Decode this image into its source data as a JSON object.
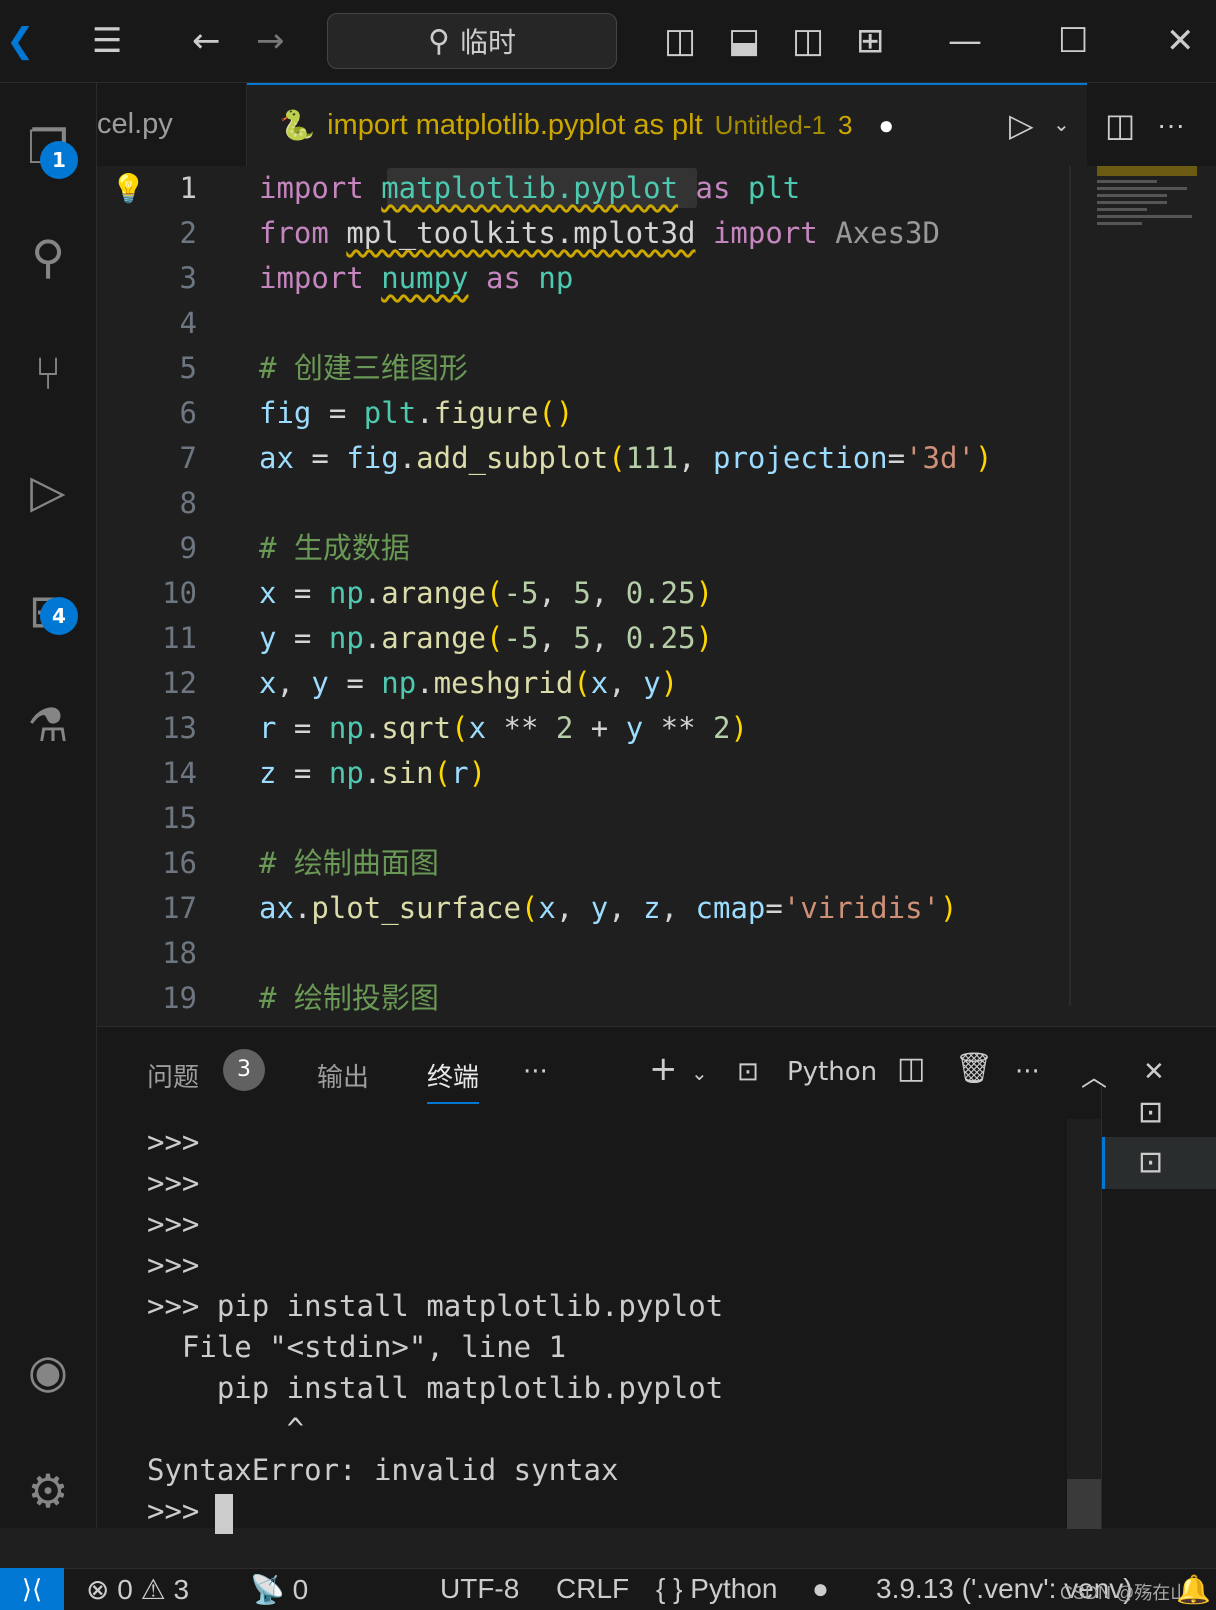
{
  "titlebar": {
    "search_text": "临时"
  },
  "activity": {
    "explorer_badge": "1",
    "extensions_badge": "4"
  },
  "tabs": [
    {
      "label": "cel.py"
    },
    {
      "label": "import matplotlib.pyplot as plt",
      "sublabel": "Untitled-1",
      "problems": "3"
    }
  ],
  "editor": {
    "lines": [
      [
        [
          "kw",
          "import "
        ],
        [
          "md sq",
          "matplotlib.pyplot"
        ],
        [
          "kw",
          " as "
        ],
        [
          "md",
          "plt"
        ]
      ],
      [
        [
          "kw",
          "from "
        ],
        [
          "p sq",
          "mpl_toolkits.mplot3d"
        ],
        [
          "kw",
          " import "
        ],
        [
          "cls",
          "Axes3D"
        ]
      ],
      [
        [
          "kw",
          "import "
        ],
        [
          "md sq",
          "numpy"
        ],
        [
          "kw",
          " as "
        ],
        [
          "md",
          "np"
        ]
      ],
      [],
      [
        [
          "c",
          "# 创建三维图形"
        ]
      ],
      [
        [
          "v",
          "fig"
        ],
        [
          "p",
          " = "
        ],
        [
          "md",
          "plt"
        ],
        [
          "p",
          "."
        ],
        [
          "fn",
          "figure"
        ],
        [
          "b",
          "()"
        ]
      ],
      [
        [
          "v",
          "ax"
        ],
        [
          "p",
          " = "
        ],
        [
          "v",
          "fig"
        ],
        [
          "p",
          "."
        ],
        [
          "fn",
          "add_subplot"
        ],
        [
          "b",
          "("
        ],
        [
          "n",
          "111"
        ],
        [
          "p",
          ", "
        ],
        [
          "v",
          "projection"
        ],
        [
          "p",
          "="
        ],
        [
          "s",
          "'3d'"
        ],
        [
          "b",
          ")"
        ]
      ],
      [],
      [
        [
          "c",
          "# 生成数据"
        ]
      ],
      [
        [
          "v",
          "x"
        ],
        [
          "p",
          " = "
        ],
        [
          "md",
          "np"
        ],
        [
          "p",
          "."
        ],
        [
          "fn",
          "arange"
        ],
        [
          "b",
          "("
        ],
        [
          "n",
          "-5"
        ],
        [
          "p",
          ", "
        ],
        [
          "n",
          "5"
        ],
        [
          "p",
          ", "
        ],
        [
          "n",
          "0.25"
        ],
        [
          "b",
          ")"
        ]
      ],
      [
        [
          "v",
          "y"
        ],
        [
          "p",
          " = "
        ],
        [
          "md",
          "np"
        ],
        [
          "p",
          "."
        ],
        [
          "fn",
          "arange"
        ],
        [
          "b",
          "("
        ],
        [
          "n",
          "-5"
        ],
        [
          "p",
          ", "
        ],
        [
          "n",
          "5"
        ],
        [
          "p",
          ", "
        ],
        [
          "n",
          "0.25"
        ],
        [
          "b",
          ")"
        ]
      ],
      [
        [
          "v",
          "x"
        ],
        [
          "p",
          ", "
        ],
        [
          "v",
          "y"
        ],
        [
          "p",
          " = "
        ],
        [
          "md",
          "np"
        ],
        [
          "p",
          "."
        ],
        [
          "fn",
          "meshgrid"
        ],
        [
          "b",
          "("
        ],
        [
          "v",
          "x"
        ],
        [
          "p",
          ", "
        ],
        [
          "v",
          "y"
        ],
        [
          "b",
          ")"
        ]
      ],
      [
        [
          "v",
          "r"
        ],
        [
          "p",
          " = "
        ],
        [
          "md",
          "np"
        ],
        [
          "p",
          "."
        ],
        [
          "fn",
          "sqrt"
        ],
        [
          "b",
          "("
        ],
        [
          "v",
          "x"
        ],
        [
          "p",
          " ** "
        ],
        [
          "n",
          "2"
        ],
        [
          "p",
          " + "
        ],
        [
          "v",
          "y"
        ],
        [
          "p",
          " ** "
        ],
        [
          "n",
          "2"
        ],
        [
          "b",
          ")"
        ]
      ],
      [
        [
          "v",
          "z"
        ],
        [
          "p",
          " = "
        ],
        [
          "md",
          "np"
        ],
        [
          "p",
          "."
        ],
        [
          "fn",
          "sin"
        ],
        [
          "b",
          "("
        ],
        [
          "v",
          "r"
        ],
        [
          "b",
          ")"
        ]
      ],
      [],
      [
        [
          "c",
          "# 绘制曲面图"
        ]
      ],
      [
        [
          "v",
          "ax"
        ],
        [
          "p",
          "."
        ],
        [
          "fn",
          "plot_surface"
        ],
        [
          "b",
          "("
        ],
        [
          "v",
          "x"
        ],
        [
          "p",
          ", "
        ],
        [
          "v",
          "y"
        ],
        [
          "p",
          ", "
        ],
        [
          "v",
          "z"
        ],
        [
          "p",
          ", "
        ],
        [
          "v",
          "cmap"
        ],
        [
          "p",
          "="
        ],
        [
          "s",
          "'viridis'"
        ],
        [
          "b",
          ")"
        ]
      ],
      [],
      [
        [
          "c",
          "# 绘制投影图"
        ]
      ]
    ]
  },
  "panel": {
    "tabs": [
      "问题",
      "输出",
      "终端"
    ],
    "problems_count": "3",
    "terminal_name": "Python",
    "terminal_lines": [
      ">>>",
      ">>>",
      ">>>",
      ">>>",
      ">>> pip install matplotlib.pyplot",
      "  File \"<stdin>\", line 1",
      "    pip install matplotlib.pyplot",
      "        ^",
      "SyntaxError: invalid syntax",
      ">>> "
    ]
  },
  "status": {
    "errors": "0",
    "warnings": "3",
    "ports": "0",
    "encoding": "UTF-8",
    "eol": "CRLF",
    "language": "Python",
    "interpreter": "3.9.13 ('.venv': venv)",
    "watermark": "CSDN @殇在山风"
  }
}
